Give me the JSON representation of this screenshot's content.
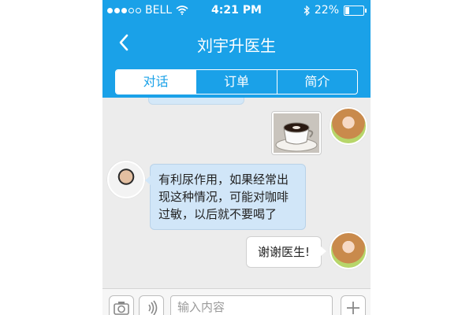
{
  "status_bar": {
    "carrier": "BELL",
    "time": "4:21 PM",
    "battery_text": "22%",
    "battery_level": 0.22
  },
  "header": {
    "title": "刘宇升医生",
    "back_icon": "chevron-left-icon"
  },
  "tabs": [
    {
      "label": "对话",
      "active": true
    },
    {
      "label": "订单",
      "active": false
    },
    {
      "label": "简介",
      "active": false
    }
  ],
  "messages": [
    {
      "sender": "patient",
      "type": "image",
      "image": "coffee-cup"
    },
    {
      "sender": "doctor",
      "type": "text",
      "text": "有利尿作用，如果经常出现这种情况，可能对咖啡过敏，以后就不要喝了"
    },
    {
      "sender": "patient",
      "type": "text",
      "text": "谢谢医生!"
    }
  ],
  "input_bar": {
    "placeholder": "输入内容",
    "camera_icon": "camera-icon",
    "voice_icon": "voice-icon",
    "add_icon": "plus-icon"
  },
  "colors": {
    "header_bg": "#1aa1e8",
    "chat_bg": "#ececec",
    "doctor_bubble": "#d1e6f8",
    "patient_bubble": "#ffffff"
  }
}
